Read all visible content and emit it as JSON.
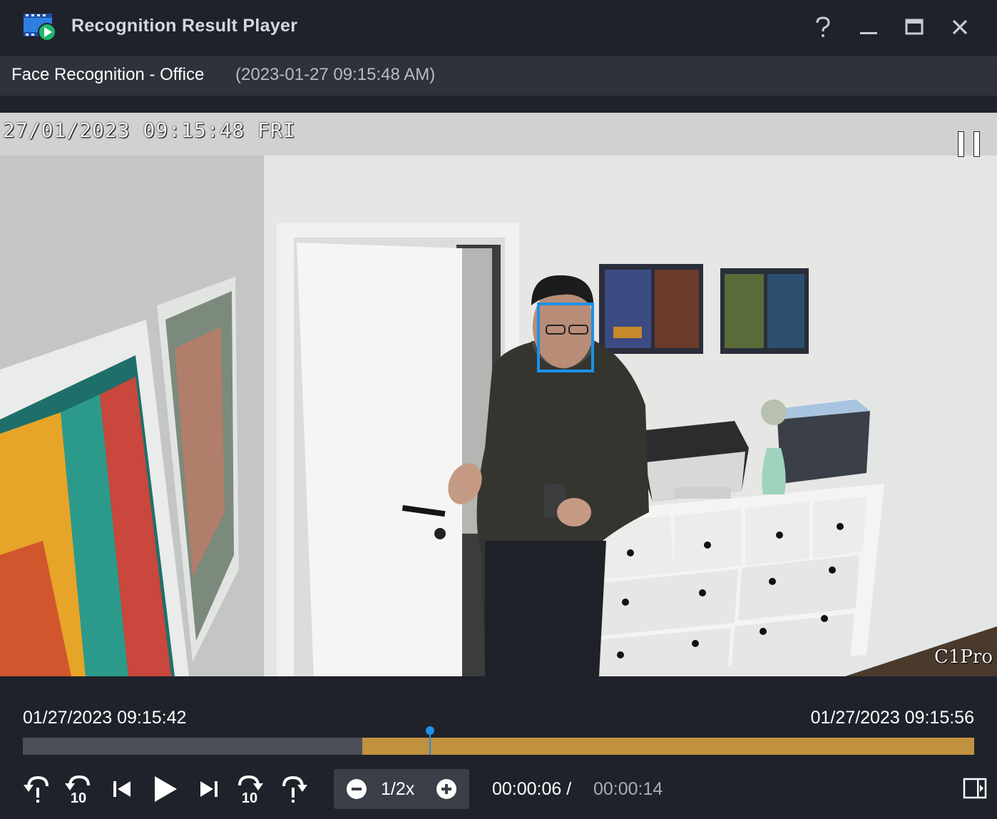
{
  "window": {
    "title": "Recognition Result Player",
    "buttons": {
      "help": "help-icon",
      "minimize": "minimize-icon",
      "maximize": "maximize-icon",
      "close": "close-icon"
    }
  },
  "header": {
    "title": "Face Recognition - Office",
    "datetime": "(2023-01-27 09:15:48 AM)"
  },
  "video": {
    "osd_timestamp": "27/01/2023 09:15:48 FRI",
    "camera_label": "C1Pro",
    "face_box_color": "#1e90e8"
  },
  "timeline": {
    "start": "01/27/2023 09:15:42",
    "end": "01/27/2023 09:15:56",
    "recognition_range_fraction": [
      0.357,
      1.0
    ],
    "playhead_fraction": 0.428,
    "recognition_color": "#c0913f"
  },
  "controls": {
    "speed": "1/2x",
    "current_time": "00:00:06",
    "separator": " / ",
    "total_time": "00:00:14",
    "skip_seconds": "10"
  }
}
